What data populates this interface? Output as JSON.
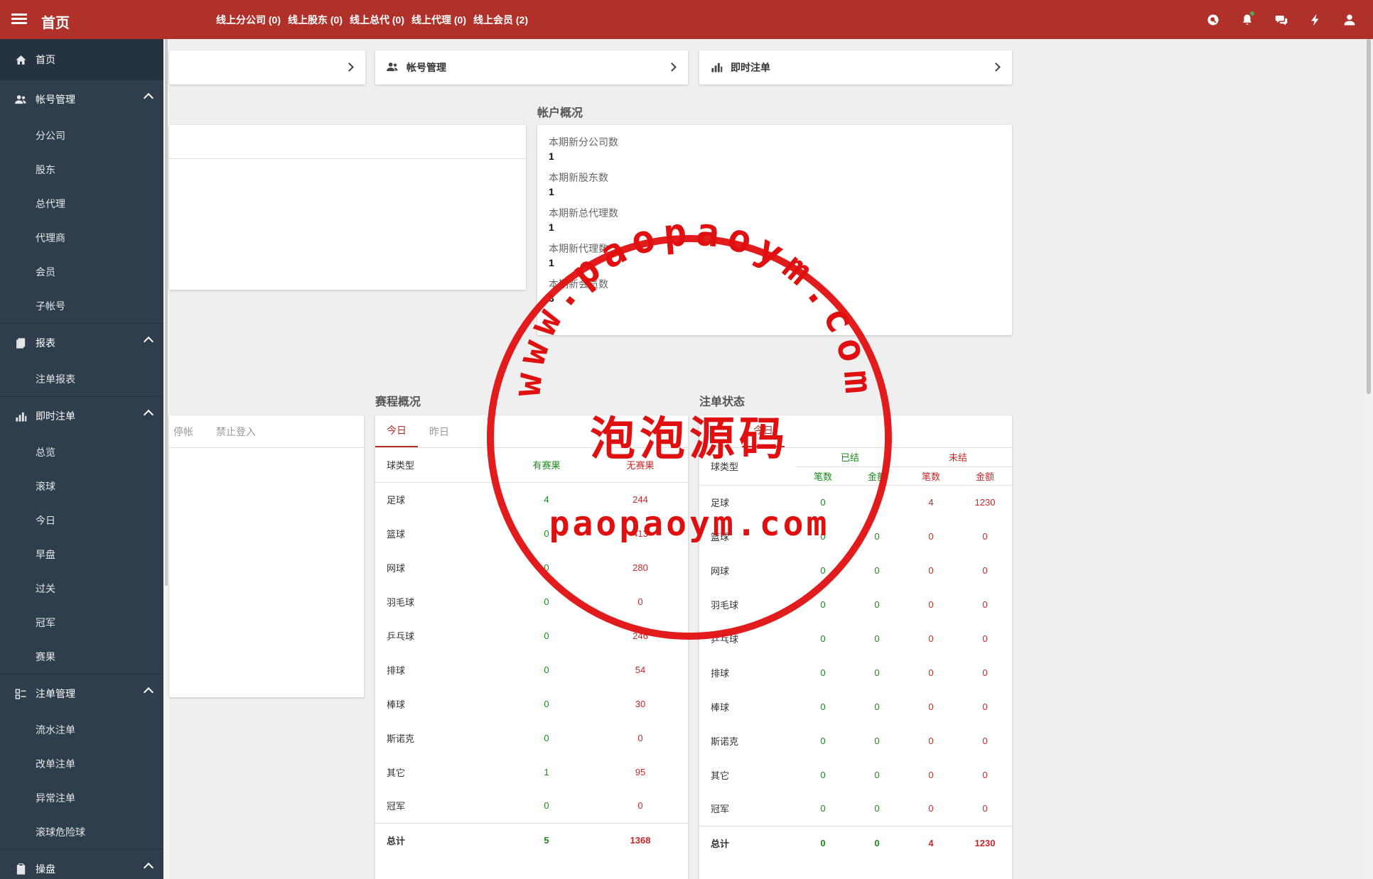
{
  "topbar": {
    "title": "首页",
    "online": [
      {
        "label": "线上分公司 (0)"
      },
      {
        "label": "线上股东 (0)"
      },
      {
        "label": "线上总代 (0)"
      },
      {
        "label": "线上代理 (0)"
      },
      {
        "label": "线上会员 (2)"
      }
    ],
    "icons": [
      "search-icon",
      "bell-icon",
      "chat-icon",
      "bolt-icon",
      "user-icon"
    ],
    "color": "#b0312a"
  },
  "sidebar": {
    "home": "首页",
    "groups": [
      {
        "label": "帐号管理",
        "icon": "users-icon",
        "items": [
          "分公司",
          "股东",
          "总代理",
          "代理商",
          "会员",
          "子帐号"
        ]
      },
      {
        "label": "报表",
        "icon": "report-icon",
        "items": [
          "注单报表"
        ]
      },
      {
        "label": "即时注单",
        "icon": "bar-chart-icon",
        "items": [
          "总览",
          "滚球",
          "今日",
          "早盘",
          "过关",
          "冠军",
          "赛果"
        ]
      },
      {
        "label": "注单管理",
        "icon": "list-icon",
        "items": [
          "流水注单",
          "改单注单",
          "异常注单",
          "滚球危险球"
        ]
      },
      {
        "label": "操盘",
        "icon": "clipboard-icon",
        "items": []
      }
    ]
  },
  "nav_cards": [
    {
      "label": "帐号管理",
      "icon": "users-icon"
    },
    {
      "label": "即时注单",
      "icon": "bar-chart-icon"
    }
  ],
  "account_overview": {
    "title": "帐户概况",
    "stats": [
      {
        "label": "本期新分公司数",
        "value": "1"
      },
      {
        "label": "本期新股东数",
        "value": "1"
      },
      {
        "label": "本期新总代理数",
        "value": "1"
      },
      {
        "label": "本期新代理数",
        "value": "1"
      },
      {
        "label": "本期新会员数",
        "value": "3"
      }
    ]
  },
  "left_panel_tabs": [
    "停帐",
    "禁止登入"
  ],
  "schedule": {
    "title": "赛程概况",
    "tabs": [
      "今日",
      "昨日"
    ],
    "headers": [
      "球类型",
      "有赛果",
      "无赛果"
    ],
    "rows": [
      [
        "足球",
        "4",
        "244"
      ],
      [
        "篮球",
        "0",
        "413"
      ],
      [
        "网球",
        "0",
        "280"
      ],
      [
        "羽毛球",
        "0",
        "0"
      ],
      [
        "乒乓球",
        "0",
        "246"
      ],
      [
        "排球",
        "0",
        "54"
      ],
      [
        "棒球",
        "0",
        "30"
      ],
      [
        "斯诺克",
        "0",
        "0"
      ],
      [
        "其它",
        "1",
        "95"
      ],
      [
        "冠军",
        "0",
        "0"
      ]
    ],
    "total": [
      "总计",
      "5",
      "1368"
    ]
  },
  "bet_status": {
    "title": "注单状态",
    "tab": "今日",
    "group_headers": [
      "已结",
      "未结"
    ],
    "headers": [
      "球类型",
      "笔数",
      "金额",
      "笔数",
      "金额"
    ],
    "rows": [
      [
        "足球",
        "0",
        "0",
        "4",
        "1230"
      ],
      [
        "篮球",
        "0",
        "0",
        "0",
        "0"
      ],
      [
        "网球",
        "0",
        "0",
        "0",
        "0"
      ],
      [
        "羽毛球",
        "0",
        "0",
        "0",
        "0"
      ],
      [
        "乒乓球",
        "0",
        "0",
        "0",
        "0"
      ],
      [
        "排球",
        "0",
        "0",
        "0",
        "0"
      ],
      [
        "棒球",
        "0",
        "0",
        "0",
        "0"
      ],
      [
        "斯诺克",
        "0",
        "0",
        "0",
        "0"
      ],
      [
        "其它",
        "0",
        "0",
        "0",
        "0"
      ],
      [
        "冠军",
        "0",
        "0",
        "0",
        "0"
      ]
    ],
    "total": [
      "总计",
      "0",
      "0",
      "4",
      "1230"
    ]
  },
  "watermark": {
    "ring_text": "www.paopaoym.com",
    "center_text": "泡泡源码",
    "bottom_text": "paopaoym.com",
    "color": "#e01010"
  }
}
